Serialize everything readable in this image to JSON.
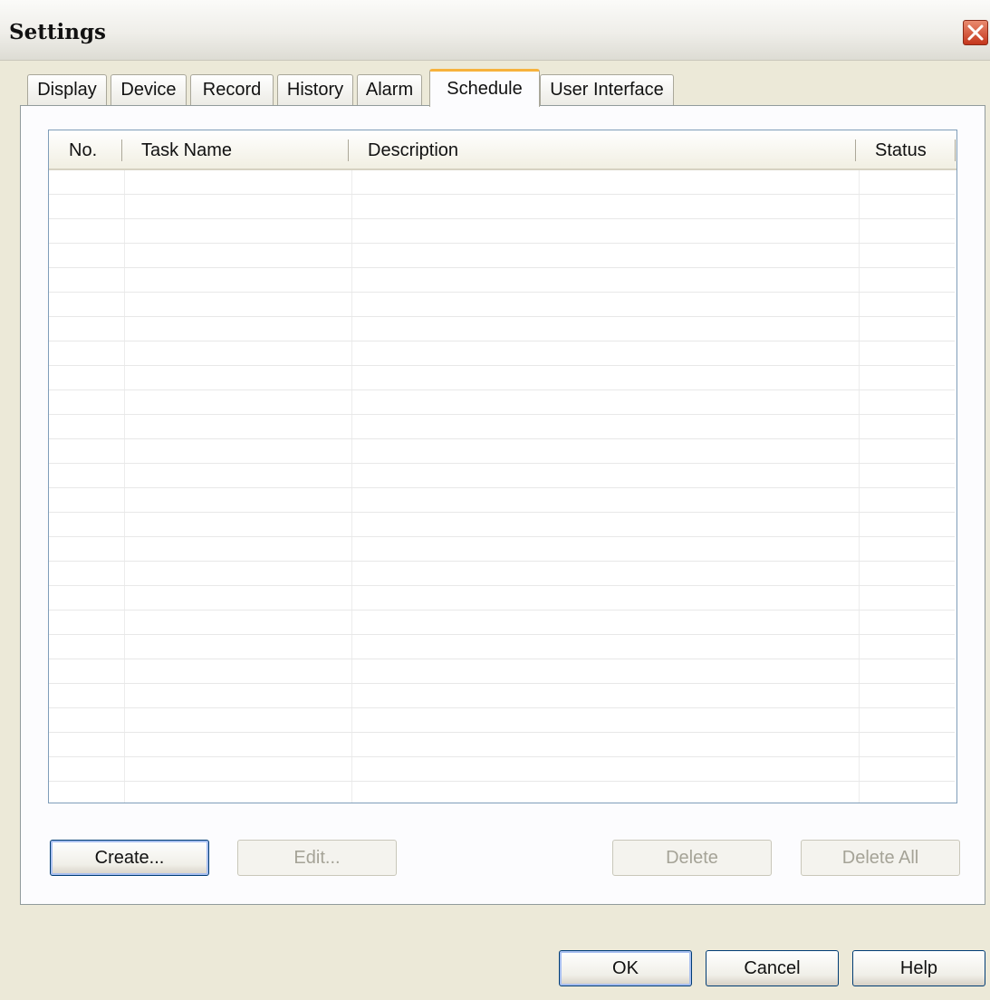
{
  "window": {
    "title": "Settings"
  },
  "tabs": [
    {
      "label": "Display"
    },
    {
      "label": "Device"
    },
    {
      "label": "Record"
    },
    {
      "label": "History"
    },
    {
      "label": "Alarm"
    },
    {
      "label": "Schedule",
      "active": true
    },
    {
      "label": "User Interface"
    }
  ],
  "schedule": {
    "columns": [
      "No.",
      "Task Name",
      "Description",
      "Status"
    ],
    "rows": [],
    "buttons": {
      "create": "Create...",
      "edit": "Edit...",
      "delete": "Delete",
      "delete_all": "Delete All"
    }
  },
  "footer": {
    "ok": "OK",
    "cancel": "Cancel",
    "help": "Help"
  },
  "colors": {
    "active_tab_accent": "#f7b23d",
    "close_button": "#c4361c",
    "button_border": "#003c74"
  },
  "icons": {
    "close": "close-icon"
  }
}
